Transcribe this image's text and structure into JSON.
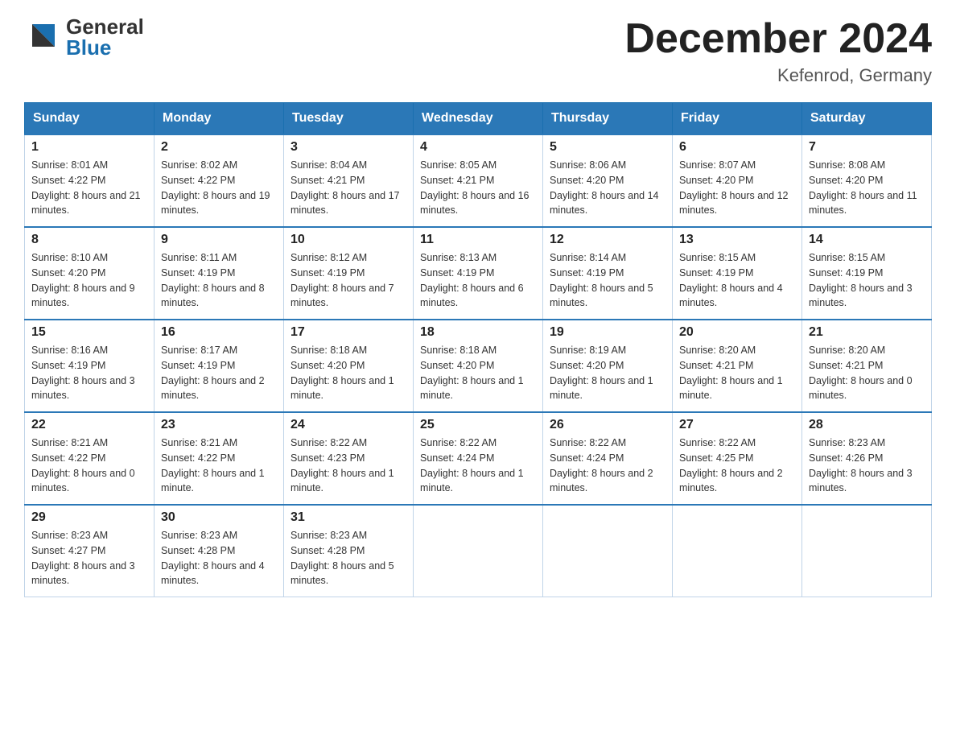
{
  "header": {
    "logo_general": "General",
    "logo_blue": "Blue",
    "title": "December 2024",
    "subtitle": "Kefenrod, Germany"
  },
  "calendar": {
    "days_of_week": [
      "Sunday",
      "Monday",
      "Tuesday",
      "Wednesday",
      "Thursday",
      "Friday",
      "Saturday"
    ],
    "weeks": [
      [
        {
          "day": "1",
          "sunrise": "8:01 AM",
          "sunset": "4:22 PM",
          "daylight": "8 hours and 21 minutes."
        },
        {
          "day": "2",
          "sunrise": "8:02 AM",
          "sunset": "4:22 PM",
          "daylight": "8 hours and 19 minutes."
        },
        {
          "day": "3",
          "sunrise": "8:04 AM",
          "sunset": "4:21 PM",
          "daylight": "8 hours and 17 minutes."
        },
        {
          "day": "4",
          "sunrise": "8:05 AM",
          "sunset": "4:21 PM",
          "daylight": "8 hours and 16 minutes."
        },
        {
          "day": "5",
          "sunrise": "8:06 AM",
          "sunset": "4:20 PM",
          "daylight": "8 hours and 14 minutes."
        },
        {
          "day": "6",
          "sunrise": "8:07 AM",
          "sunset": "4:20 PM",
          "daylight": "8 hours and 12 minutes."
        },
        {
          "day": "7",
          "sunrise": "8:08 AM",
          "sunset": "4:20 PM",
          "daylight": "8 hours and 11 minutes."
        }
      ],
      [
        {
          "day": "8",
          "sunrise": "8:10 AM",
          "sunset": "4:20 PM",
          "daylight": "8 hours and 9 minutes."
        },
        {
          "day": "9",
          "sunrise": "8:11 AM",
          "sunset": "4:19 PM",
          "daylight": "8 hours and 8 minutes."
        },
        {
          "day": "10",
          "sunrise": "8:12 AM",
          "sunset": "4:19 PM",
          "daylight": "8 hours and 7 minutes."
        },
        {
          "day": "11",
          "sunrise": "8:13 AM",
          "sunset": "4:19 PM",
          "daylight": "8 hours and 6 minutes."
        },
        {
          "day": "12",
          "sunrise": "8:14 AM",
          "sunset": "4:19 PM",
          "daylight": "8 hours and 5 minutes."
        },
        {
          "day": "13",
          "sunrise": "8:15 AM",
          "sunset": "4:19 PM",
          "daylight": "8 hours and 4 minutes."
        },
        {
          "day": "14",
          "sunrise": "8:15 AM",
          "sunset": "4:19 PM",
          "daylight": "8 hours and 3 minutes."
        }
      ],
      [
        {
          "day": "15",
          "sunrise": "8:16 AM",
          "sunset": "4:19 PM",
          "daylight": "8 hours and 3 minutes."
        },
        {
          "day": "16",
          "sunrise": "8:17 AM",
          "sunset": "4:19 PM",
          "daylight": "8 hours and 2 minutes."
        },
        {
          "day": "17",
          "sunrise": "8:18 AM",
          "sunset": "4:20 PM",
          "daylight": "8 hours and 1 minute."
        },
        {
          "day": "18",
          "sunrise": "8:18 AM",
          "sunset": "4:20 PM",
          "daylight": "8 hours and 1 minute."
        },
        {
          "day": "19",
          "sunrise": "8:19 AM",
          "sunset": "4:20 PM",
          "daylight": "8 hours and 1 minute."
        },
        {
          "day": "20",
          "sunrise": "8:20 AM",
          "sunset": "4:21 PM",
          "daylight": "8 hours and 1 minute."
        },
        {
          "day": "21",
          "sunrise": "8:20 AM",
          "sunset": "4:21 PM",
          "daylight": "8 hours and 0 minutes."
        }
      ],
      [
        {
          "day": "22",
          "sunrise": "8:21 AM",
          "sunset": "4:22 PM",
          "daylight": "8 hours and 0 minutes."
        },
        {
          "day": "23",
          "sunrise": "8:21 AM",
          "sunset": "4:22 PM",
          "daylight": "8 hours and 1 minute."
        },
        {
          "day": "24",
          "sunrise": "8:22 AM",
          "sunset": "4:23 PM",
          "daylight": "8 hours and 1 minute."
        },
        {
          "day": "25",
          "sunrise": "8:22 AM",
          "sunset": "4:24 PM",
          "daylight": "8 hours and 1 minute."
        },
        {
          "day": "26",
          "sunrise": "8:22 AM",
          "sunset": "4:24 PM",
          "daylight": "8 hours and 2 minutes."
        },
        {
          "day": "27",
          "sunrise": "8:22 AM",
          "sunset": "4:25 PM",
          "daylight": "8 hours and 2 minutes."
        },
        {
          "day": "28",
          "sunrise": "8:23 AM",
          "sunset": "4:26 PM",
          "daylight": "8 hours and 3 minutes."
        }
      ],
      [
        {
          "day": "29",
          "sunrise": "8:23 AM",
          "sunset": "4:27 PM",
          "daylight": "8 hours and 3 minutes."
        },
        {
          "day": "30",
          "sunrise": "8:23 AM",
          "sunset": "4:28 PM",
          "daylight": "8 hours and 4 minutes."
        },
        {
          "day": "31",
          "sunrise": "8:23 AM",
          "sunset": "4:28 PM",
          "daylight": "8 hours and 5 minutes."
        },
        null,
        null,
        null,
        null
      ]
    ]
  }
}
